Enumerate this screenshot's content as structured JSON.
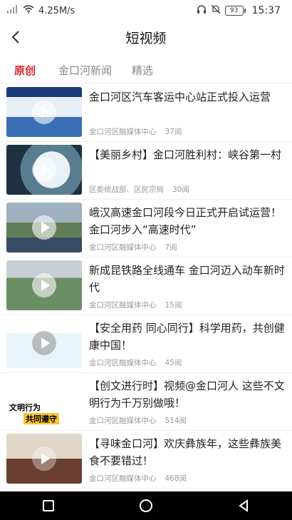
{
  "status_bar": {
    "speed": "4.25M/s",
    "battery": "93",
    "time": "15:37"
  },
  "header": {
    "title": "短视频"
  },
  "tabs": [
    {
      "label": "原创",
      "active": true
    },
    {
      "label": "金口河新闻",
      "active": false
    },
    {
      "label": "精选",
      "active": false
    }
  ],
  "items": [
    {
      "title": "金口河区汽车客运中心站正式投入运营",
      "source": "金口河区融媒体中心",
      "views": "37阅"
    },
    {
      "title": "【美丽乡村】金口河胜利村：峡谷第一村",
      "source": "区委统战部、区民宗局",
      "views": "30阅"
    },
    {
      "title": "峨汉高速金口河段今日正式开启试运营！金口河步入“高速时代”",
      "source": "金口河区融媒体中心",
      "views": "7阅"
    },
    {
      "title": "新成昆铁路全线通车 金口河迈入动车新时代",
      "source": "金口河区融媒体中心",
      "views": "15阅"
    },
    {
      "title": "【安全用药 同心同行】科学用药，共创健康中国！",
      "source": "金口河区融媒体中心",
      "views": "45阅"
    },
    {
      "title": "【创文进行时】视频@金口河人 这些不文明行为千万别做哦！",
      "source": "金口河区融媒体中心",
      "views": "514阅",
      "thumb_text_1": "文明行为",
      "thumb_text_2": "共同遵守"
    },
    {
      "title": "【寻味金口河】欢庆彝族年，这些彝族美食不要错过！",
      "source": "金口河区融媒体中心",
      "views": "468阅"
    }
  ]
}
